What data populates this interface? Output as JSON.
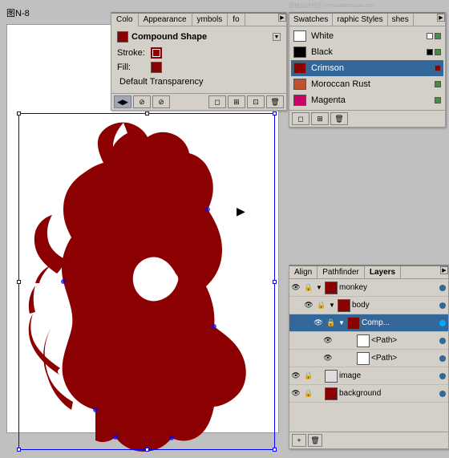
{
  "app": {
    "title": "图N-8"
  },
  "color_panel": {
    "tabs": [
      "Colo",
      "Appearance",
      "ymbols",
      "fo"
    ],
    "compound_shape_label": "Compound Shape",
    "stroke_label": "Stroke:",
    "fill_label": "Fill:",
    "default_transparency_label": "Default Transparency"
  },
  "swatches_panel": {
    "tabs": [
      "Swatches",
      "raphic Styles",
      "shes"
    ],
    "items": [
      {
        "name": "White",
        "color": "#ffffff",
        "selected": false
      },
      {
        "name": "Black",
        "color": "#000000",
        "selected": false
      },
      {
        "name": "Crimson",
        "color": "#8b0000",
        "selected": true
      },
      {
        "name": "Moroccan Rust",
        "color": "#a0522d",
        "selected": false
      },
      {
        "name": "Magenta",
        "color": "#cc0066",
        "selected": false
      }
    ]
  },
  "layers_panel": {
    "tabs": [
      "Align",
      "Pathfinder",
      "Layers"
    ],
    "active_tab": "Layers",
    "rows": [
      {
        "name": "monkey",
        "indent": 0,
        "thumb_color": "#8b0000",
        "has_eye": true,
        "has_lock": true,
        "expanded": true,
        "dot_color": "#336699"
      },
      {
        "name": "body",
        "indent": 1,
        "thumb_color": "#8b0000",
        "has_eye": true,
        "has_lock": true,
        "expanded": true,
        "dot_color": "#336699"
      },
      {
        "name": "Comp...",
        "indent": 2,
        "thumb_color": "#8b0000",
        "has_eye": true,
        "has_lock": true,
        "expanded": true,
        "selected": true,
        "dot_color": "#00aaff"
      },
      {
        "name": "<Path>",
        "indent": 3,
        "thumb_color": "#fff",
        "has_eye": true,
        "has_lock": false,
        "expanded": false,
        "dot_color": "#336699"
      },
      {
        "name": "<Path>",
        "indent": 3,
        "thumb_color": "#fff",
        "has_eye": true,
        "has_lock": false,
        "expanded": false,
        "dot_color": "#336699"
      },
      {
        "name": "image",
        "indent": 0,
        "thumb_color": "#ddd",
        "has_eye": true,
        "has_lock": true,
        "expanded": false,
        "dot_color": "#336699"
      },
      {
        "name": "background",
        "indent": 0,
        "thumb_color": "#8b0000",
        "has_eye": true,
        "has_lock": true,
        "expanded": false,
        "dot_color": "#336699"
      }
    ]
  },
  "canvas": {
    "label": "图N-8"
  },
  "cursor": "►"
}
